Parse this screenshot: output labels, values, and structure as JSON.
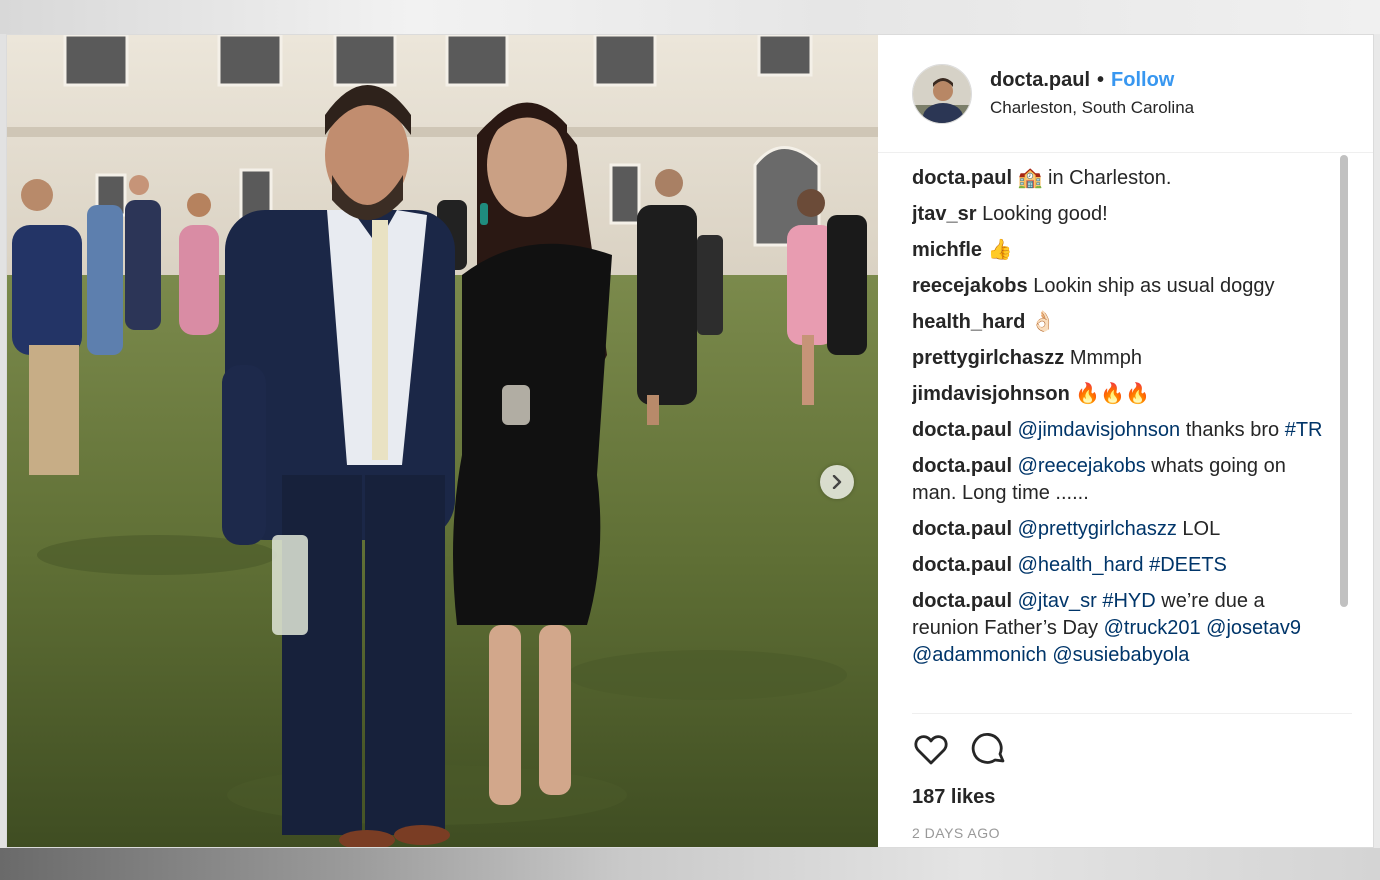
{
  "header": {
    "username": "docta.paul",
    "separator": "•",
    "follow_label": "Follow",
    "location": "Charleston, South Carolina"
  },
  "comments": [
    {
      "user": "docta.paul",
      "text": "🏫 in Charleston."
    },
    {
      "user": "jtav_sr",
      "text": "Looking good!"
    },
    {
      "user": "michfle",
      "text": "👍"
    },
    {
      "user": "reecejakobs",
      "text": "Lookin ship as usual doggy"
    },
    {
      "user": "health_hard",
      "text": "👌🏻"
    },
    {
      "user": "prettygirlchaszz",
      "text": "Mmmph"
    },
    {
      "user": "jimdavisjohnson",
      "text": "🔥🔥🔥"
    },
    {
      "user": "docta.paul",
      "mention": "@jimdavisjohnson",
      "text": "thanks bro",
      "tag": "#TR"
    },
    {
      "user": "docta.paul",
      "mention": "@reecejakobs",
      "text": "whats going on man. Long time ......"
    },
    {
      "user": "docta.paul",
      "mention": "@prettygirlchaszz",
      "text": "LOL"
    },
    {
      "user": "docta.paul",
      "mention": "@health_hard",
      "tag": "#DEETS"
    },
    {
      "user": "docta.paul",
      "mention": "@jtav_sr",
      "tag": "#HYD",
      "text": "we’re due a reunion Father’s Day",
      "mention2": "@truck201",
      "mention3": "@josetav9",
      "mention4": "@adammonich",
      "mention5": "@susiebabyola"
    }
  ],
  "actions": {
    "like_icon": "heart-icon",
    "comment_icon": "speech-bubble-icon",
    "likes": "187 likes",
    "time_ago": "2 DAYS AGO"
  },
  "media": {
    "next_icon": "chevron-right-icon"
  }
}
